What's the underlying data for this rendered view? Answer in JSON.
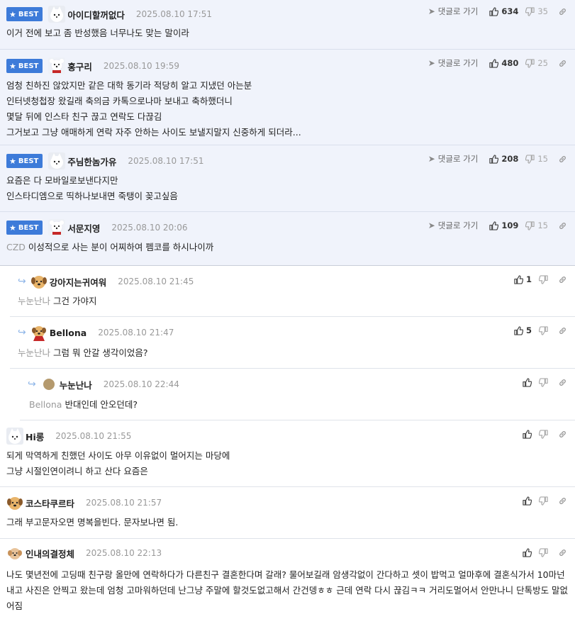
{
  "best_label": "BEST",
  "reply_to_label": "댓글로 가기",
  "comments": [
    {
      "nick": "아이디할꺼없다",
      "date": "2025.08.10 17:51",
      "lines": [
        "이거 전에 보고 좀 반성했음 너무나도 맞는 말이라"
      ],
      "likes": "634",
      "dislikes": "35"
    },
    {
      "nick": "홍구리",
      "date": "2025.08.10 19:59",
      "lines": [
        "엄청 친하진 않았지만 같은 대학 동기라 적당히 알고 지냈던 아는분",
        "인터넷청첩장 왔길래 축의금 카톡으로나마 보내고 축하했더니",
        "몇달 뒤에 인스타 친구 끊고 연락도 다끊김",
        "그거보고 그냥 애매하게 연락 자주 안하는 사이도 보낼지말지 신중하게 되더라..."
      ],
      "likes": "480",
      "dislikes": "25"
    },
    {
      "nick": "주님한놈가유",
      "date": "2025.08.10 17:51",
      "lines": [
        "요즘은 다 모바일로보낸다지만",
        "인스타디엠으로 띡하나보내면 죽탱이 꽂고싶음"
      ],
      "likes": "208",
      "dislikes": "15"
    },
    {
      "nick": "서문지영",
      "date": "2025.08.10 20:06",
      "mention": "CZD",
      "lines": [
        "이성적으로 사는 분이 어찌하여 펨코를 하시나이까"
      ],
      "likes": "109",
      "dislikes": "15"
    },
    {
      "nick": "강아지는귀여워",
      "date": "2025.08.10 21:45",
      "mention": "누눈난나",
      "lines": [
        "그건 가야지"
      ],
      "likes": "1"
    },
    {
      "nick": "Bellona",
      "date": "2025.08.10 21:47",
      "mention": "누눈난나",
      "lines": [
        "그럼 뭐 안갈 생각이었음?"
      ],
      "likes": "5"
    },
    {
      "nick": "누눈난나",
      "date": "2025.08.10 22:44",
      "mention": "Bellona",
      "lines": [
        "반대인데 안오던데?"
      ]
    },
    {
      "nick": "Hi롱",
      "date": "2025.08.10 21:55",
      "lines": [
        "되게 막역하게 친했던 사이도 아무 이유없이 멀어지는 마당에",
        "그냥 시절인연이려니 하고 산다 요즘은"
      ]
    },
    {
      "nick": "코스타쿠르타",
      "date": "2025.08.10 21:57",
      "lines": [
        "그래 부고문자오면 명복을빈다. 문자보나면 됨."
      ]
    },
    {
      "nick": "인내의결정체",
      "date": "2025.08.10 22:13",
      "lines": [
        "나도 몇년전에 고딩때 친구랑 올만에 연락하다가 다른친구 결혼한다며 갈래? 물어보길래 암생각없이 간다하고 셋이 밥먹고 얼마후에 결혼식가서 10마넌내고 사진은 안찍고 왔는데 엄청 고마워하던데 난그냥 주말에 할것도없고해서 간건뎅ㅎㅎ 근데 연락 다시 끊김ㅋㅋ 거리도멀어서 안만나니 단톡방도 말없어짐"
      ]
    }
  ]
}
